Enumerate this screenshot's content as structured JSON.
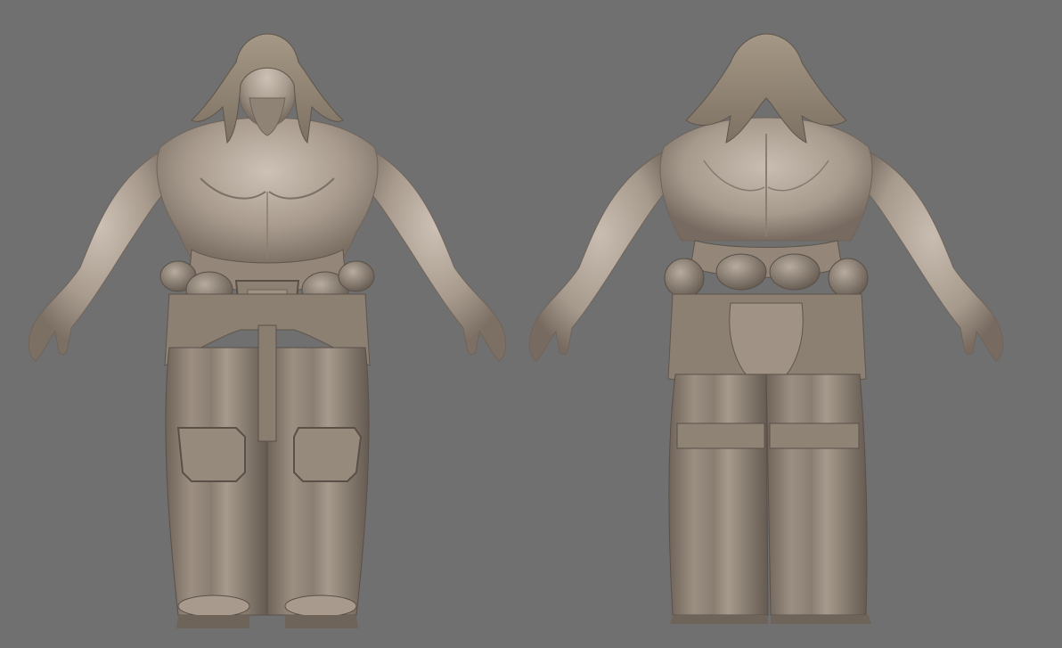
{
  "scene": {
    "background_color": "#707070",
    "clay_color": "#a3968a",
    "clay_light": "#c7bbaf",
    "clay_dark": "#6f645a",
    "clay_shadow": "#5a5048",
    "views": [
      {
        "id": "front",
        "description_name": "character-front-view"
      },
      {
        "id": "back",
        "description_name": "character-back-view"
      }
    ]
  }
}
